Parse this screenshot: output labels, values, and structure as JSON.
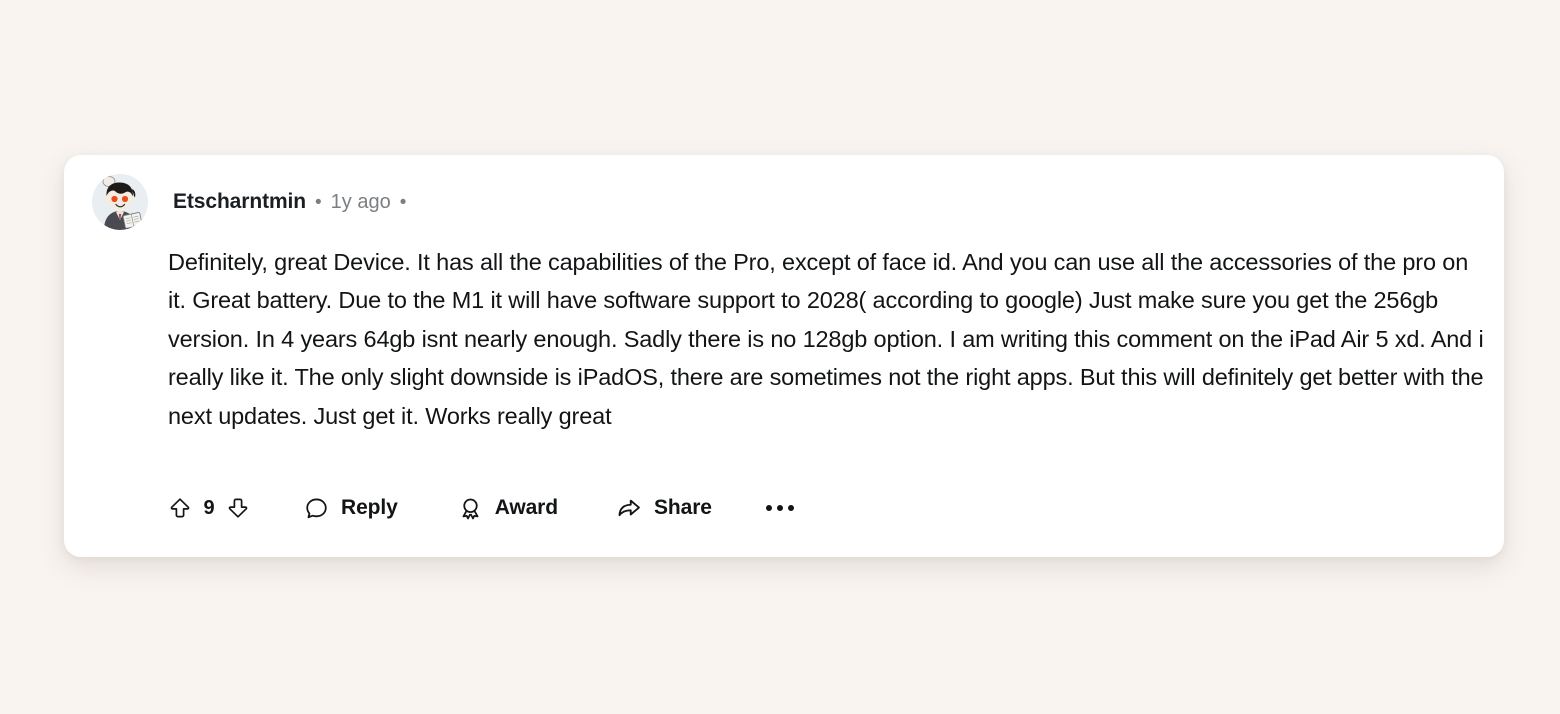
{
  "page": {
    "background_color": "#f9f4f0",
    "card_background": "#ffffff"
  },
  "comment": {
    "author": "Etscharntmin",
    "separator_1": "•",
    "timestamp": "1y ago",
    "separator_2": "•",
    "avatar_name": "reddit-snoo-avatar",
    "body": "Definitely, great Device. It has all the capabilities of the Pro, except of face id. And you can use all the accessories of the pro on it. Great battery. Due to the M1 it will have software support to 2028( according to google) Just make sure you get the 256gb version. In 4 years 64gb isnt nearly enough. Sadly there is no 128gb option. I am writing this comment on the iPad Air 5 xd. And i really like it. The only slight downside is iPadOS, there are sometimes not the right apps. But this will definitely get better with the next updates. Just get it. Works really great",
    "actions": {
      "upvote_icon": "upvote-arrow-icon",
      "score": "9",
      "downvote_icon": "downvote-arrow-icon",
      "reply_label": "Reply",
      "reply_icon": "comment-bubble-icon",
      "award_label": "Award",
      "award_icon": "award-medal-icon",
      "share_label": "Share",
      "share_icon": "share-arrow-icon",
      "more_icon": "more-options-icon"
    },
    "colors": {
      "text": "#121416",
      "muted_text": "#7c7f82",
      "avatar_background": "#e8edf1"
    }
  }
}
